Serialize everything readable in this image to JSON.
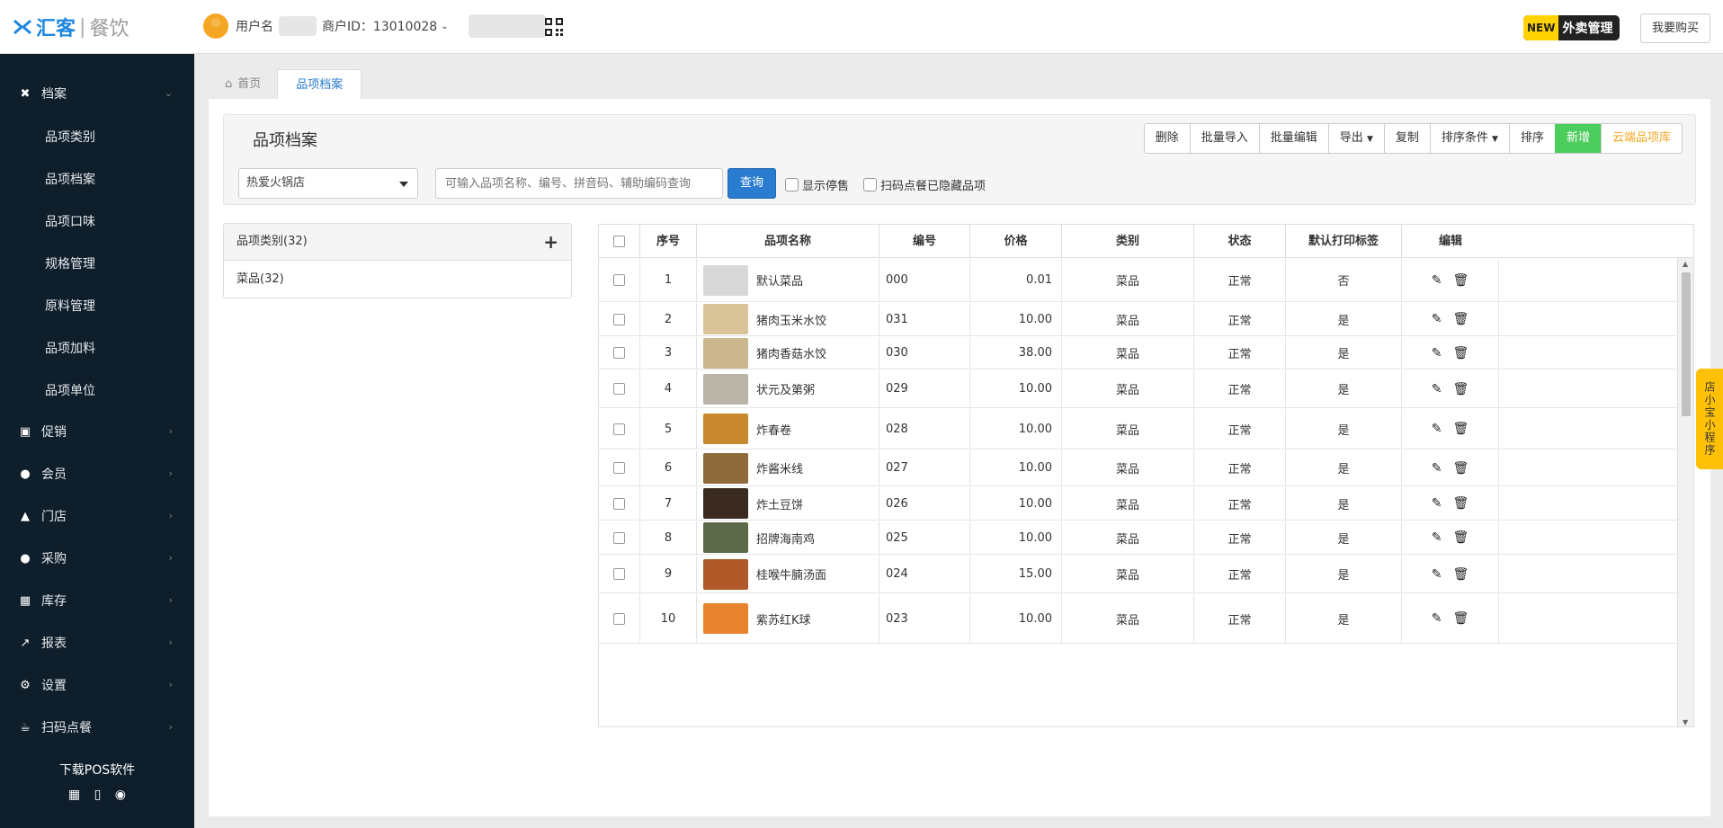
{
  "app": {
    "brand": "汇客",
    "brand_sub": "餐饮"
  },
  "header": {
    "user_label": "用户名",
    "merchant_id": "商户ID：13010028",
    "waimai_new": "NEW",
    "waimai_label": "外卖管理",
    "buy_label": "我要购买"
  },
  "sidebar": {
    "sections": [
      {
        "label": "档案",
        "icon": "utensils-icon"
      },
      {
        "label": "促销",
        "icon": "gift-icon"
      },
      {
        "label": "会员",
        "icon": "users-icon"
      },
      {
        "label": "门店",
        "icon": "bank-icon"
      },
      {
        "label": "采购",
        "icon": "users-icon"
      },
      {
        "label": "库存",
        "icon": "cubes-icon"
      },
      {
        "label": "报表",
        "icon": "chart-icon"
      },
      {
        "label": "设置",
        "icon": "gear-icon"
      },
      {
        "label": "扫码点餐",
        "icon": "coffee-icon"
      }
    ],
    "sub_items": [
      "品项类别",
      "品项档案",
      "品项口味",
      "规格管理",
      "原料管理",
      "品项加料",
      "品项单位"
    ],
    "download": "下载POS软件"
  },
  "tabs": [
    {
      "label": "首页"
    },
    {
      "label": "品项档案"
    }
  ],
  "panel": {
    "title": "品项档案",
    "buttons": [
      "删除",
      "批量导入",
      "批量编辑",
      "导出",
      "复制",
      "排序条件",
      "排序",
      "新增",
      "云端品项库"
    ],
    "store": "热爱火锅店",
    "search_placeholder": "可输入品项名称、编号、拼音码、辅助编码查询",
    "query": "查询",
    "show_stopped": "显示停售",
    "hidden_label": "扫码点餐已隐藏品项"
  },
  "categories": {
    "header": "品项类别(32)",
    "items": [
      "菜品(32)"
    ]
  },
  "table": {
    "headers": [
      "序号",
      "品项名称",
      "编号",
      "价格",
      "类别",
      "状态",
      "默认打印标签",
      "编辑"
    ],
    "rows": [
      {
        "no": "1",
        "name": "默认菜品",
        "code": "000",
        "price": "0.01",
        "cat": "菜品",
        "status": "正常",
        "label": "否",
        "color": "#d8d8d8"
      },
      {
        "no": "2",
        "name": "猪肉玉米水饺",
        "code": "031",
        "price": "10.00",
        "cat": "菜品",
        "status": "正常",
        "label": "是",
        "color": "#d9c49a"
      },
      {
        "no": "3",
        "name": "猪肉香菇水饺",
        "code": "030",
        "price": "38.00",
        "cat": "菜品",
        "status": "正常",
        "label": "是",
        "color": "#cbb88f"
      },
      {
        "no": "4",
        "name": "状元及第粥",
        "code": "029",
        "price": "10.00",
        "cat": "菜品",
        "status": "正常",
        "label": "是",
        "color": "#b9b3a8"
      },
      {
        "no": "5",
        "name": "炸春卷",
        "code": "028",
        "price": "10.00",
        "cat": "菜品",
        "status": "正常",
        "label": "是",
        "color": "#c8892e"
      },
      {
        "no": "6",
        "name": "炸酱米线",
        "code": "027",
        "price": "10.00",
        "cat": "菜品",
        "status": "正常",
        "label": "是",
        "color": "#8f6a3a"
      },
      {
        "no": "7",
        "name": "炸土豆饼",
        "code": "026",
        "price": "10.00",
        "cat": "菜品",
        "status": "正常",
        "label": "是",
        "color": "#3a2a20"
      },
      {
        "no": "8",
        "name": "招牌海南鸡",
        "code": "025",
        "price": "10.00",
        "cat": "菜品",
        "status": "正常",
        "label": "是",
        "color": "#5d6a4a"
      },
      {
        "no": "9",
        "name": "桂喉牛腩汤面",
        "code": "024",
        "price": "15.00",
        "cat": "菜品",
        "status": "正常",
        "label": "是",
        "color": "#b05a2a"
      },
      {
        "no": "10",
        "name": "紫苏红K球",
        "code": "023",
        "price": "10.00",
        "cat": "菜品",
        "status": "正常",
        "label": "是",
        "color": "#e8852e"
      }
    ]
  },
  "mini_program": "店小宝小程序"
}
